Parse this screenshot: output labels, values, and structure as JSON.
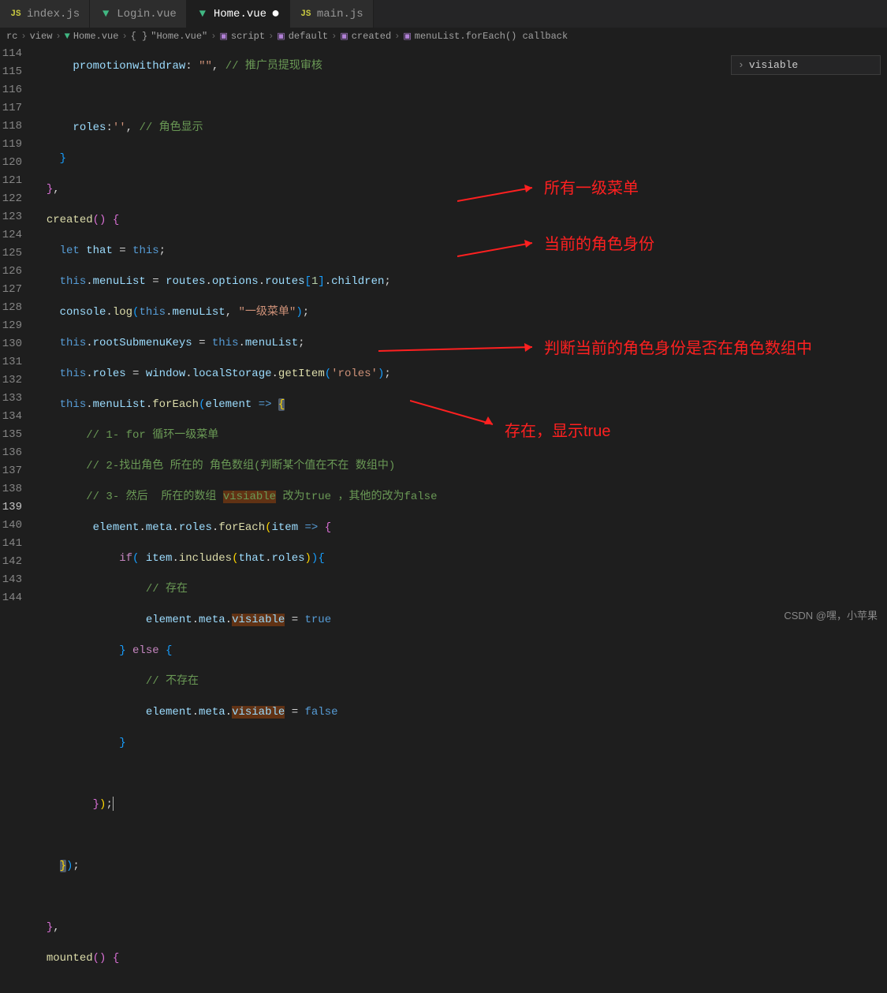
{
  "tabs": [
    {
      "label": "index.js",
      "icon": "js"
    },
    {
      "label": "Login.vue",
      "icon": "vue"
    },
    {
      "label": "Home.vue",
      "icon": "vue",
      "active": true,
      "dirty": true
    },
    {
      "label": "main.js",
      "icon": "js"
    }
  ],
  "breadcrumbs": [
    "rc",
    "view",
    "Home.vue",
    "\"Home.vue\"",
    "script",
    "default",
    "created",
    "menuList.forEach() callback"
  ],
  "outline": {
    "label": "visiable"
  },
  "gutter": {
    "start": 114,
    "end": 144,
    "current": 139
  },
  "code": {
    "l114": {
      "prop": "promotionwithdraw",
      "val": "\"\"",
      "cmt": "// 推广员提现审核"
    },
    "l117": {
      "prop": "roles",
      "val": "''",
      "cmt": "// 角色显示"
    },
    "l120": {
      "fn": "created"
    },
    "l121": {
      "kw": "let",
      "v1": "that",
      "v2": "this"
    },
    "l122_a": "this",
    "l122_b": "menuList",
    "l122_c": "routes",
    "l122_d": "options",
    "l122_e": "routes",
    "l122_f": "1",
    "l122_g": "children",
    "l123_a": "console",
    "l123_b": "log",
    "l123_c": "this",
    "l123_d": "menuList",
    "l123_e": "\"一级菜单\"",
    "l124_a": "this",
    "l124_b": "rootSubmenuKeys",
    "l124_c": "this",
    "l124_d": "menuList",
    "l125_a": "this",
    "l125_b": "roles",
    "l125_c": "window",
    "l125_d": "localStorage",
    "l125_e": "getItem",
    "l125_f": "'roles'",
    "l126_a": "this",
    "l126_b": "menuList",
    "l126_c": "forEach",
    "l126_d": "element",
    "l127": "// 1- for 循环一级菜单",
    "l128": "// 2-找出角色 所在的 角色数组(判断某个值在不在 数组中)",
    "l129_a": "// 3- 然后  所在的数组 ",
    "l129_b": "visiable",
    "l129_c": " 改为true ，其他的改为false",
    "l130_a": "element",
    "l130_b": "meta",
    "l130_c": "roles",
    "l130_d": "forEach",
    "l130_e": "item",
    "l131_a": "if",
    "l131_b": "item",
    "l131_c": "includes",
    "l131_d": "that",
    "l131_e": "roles",
    "l132": "// 存在",
    "l133_a": "element",
    "l133_b": "meta",
    "l133_c": "visiable",
    "l133_d": "true",
    "l134": "else",
    "l135": "// 不存在",
    "l136_a": "element",
    "l136_b": "meta",
    "l136_c": "visiable",
    "l136_d": "false",
    "l144": "mounted"
  },
  "annotations": {
    "a1": "所有一级菜单",
    "a2": "当前的角色身份",
    "a3": "判断当前的角色身份是否在角色数组中",
    "a4": "存在，显示true"
  },
  "watermark": "CSDN @嘿，小苹果"
}
